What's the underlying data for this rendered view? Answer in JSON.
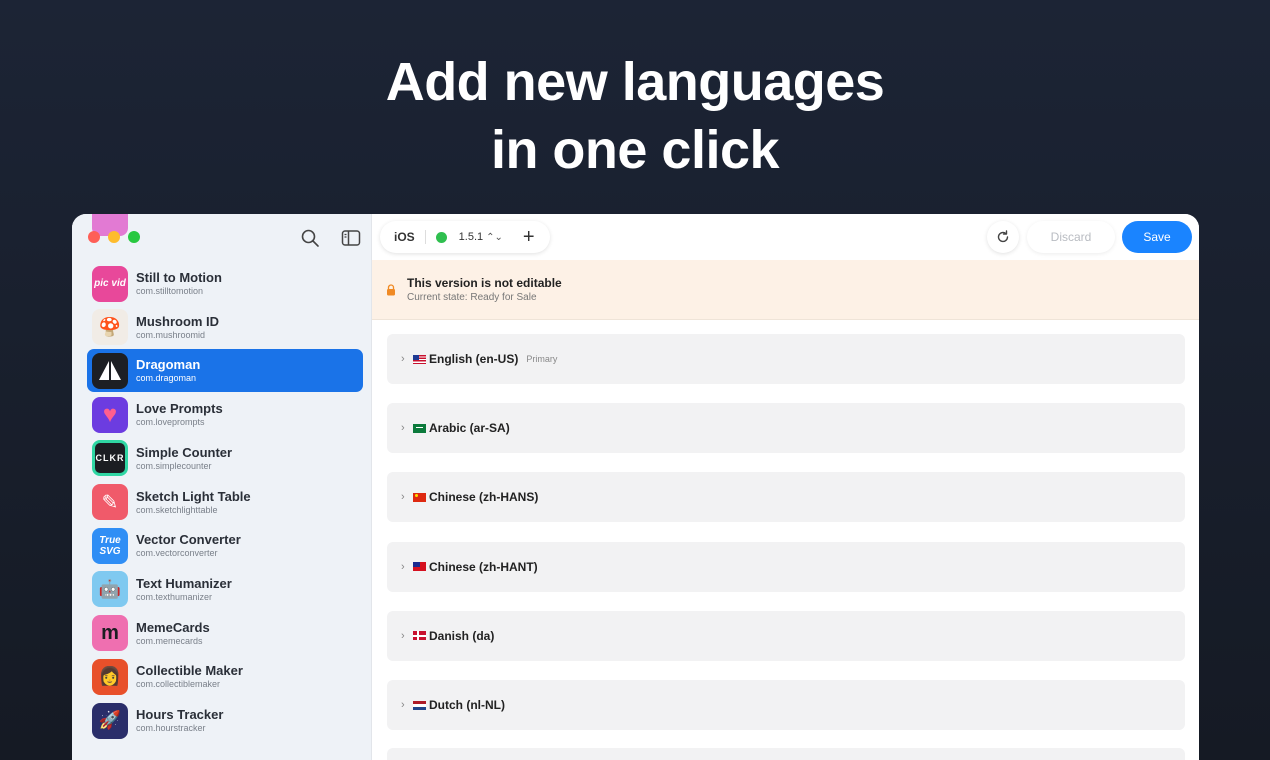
{
  "headline": {
    "line1": "Add new languages",
    "line2": "in one click"
  },
  "sidebar": {
    "apps": [
      {
        "name": "Still to Motion",
        "id": "com.stilltomotion",
        "icon_text": "pic vid",
        "icon_color": "#e8489a"
      },
      {
        "name": "Mushroom ID",
        "id": "com.mushroomid",
        "icon_text": "🍄",
        "icon_color": "#f1ece6"
      },
      {
        "name": "Dragoman",
        "id": "com.dragoman",
        "icon_text": "",
        "icon_color": "#1d1f24",
        "selected": true
      },
      {
        "name": "Love Prompts",
        "id": "com.loveprompts",
        "icon_text": "♥",
        "icon_color": "#6c3ce0"
      },
      {
        "name": "Simple Counter",
        "id": "com.simplecounter",
        "icon_text": "CLKR",
        "icon_color": "#2fd6a3"
      },
      {
        "name": "Sketch Light Table",
        "id": "com.sketchlighttable",
        "icon_text": "✎",
        "icon_color": "#f05a6a"
      },
      {
        "name": "Vector Converter",
        "id": "com.vectorconverter",
        "icon_text": "True SVG",
        "icon_color": "#2f8ef5"
      },
      {
        "name": "Text Humanizer",
        "id": "com.texthumanizer",
        "icon_text": "🤖",
        "icon_color": "#7fc9f0"
      },
      {
        "name": "MemeCards",
        "id": "com.memecards",
        "icon_text": "m",
        "icon_color": "#ef6fb0"
      },
      {
        "name": "Collectible Maker",
        "id": "com.collectiblemaker",
        "icon_text": "👩",
        "icon_color": "#e8502a"
      },
      {
        "name": "Hours Tracker",
        "id": "com.hourstracker",
        "icon_text": "🚀",
        "icon_color": "#2a2e6a"
      }
    ]
  },
  "toolbar": {
    "platform": "iOS",
    "version": "1.5.1",
    "status_color": "#2fbf4f",
    "discard_label": "Discard",
    "save_label": "Save"
  },
  "banner": {
    "title": "This version is not editable",
    "subtitle": "Current state: Ready for Sale"
  },
  "languages": [
    {
      "flag": "us",
      "name": "English (en-US)",
      "tag": "Primary"
    },
    {
      "flag": "sa",
      "name": "Arabic (ar-SA)",
      "tag": ""
    },
    {
      "flag": "cn",
      "name": "Chinese (zh-HANS)",
      "tag": ""
    },
    {
      "flag": "tw",
      "name": "Chinese (zh-HANT)",
      "tag": ""
    },
    {
      "flag": "dk",
      "name": "Danish (da)",
      "tag": ""
    },
    {
      "flag": "nl",
      "name": "Dutch (nl-NL)",
      "tag": ""
    }
  ]
}
